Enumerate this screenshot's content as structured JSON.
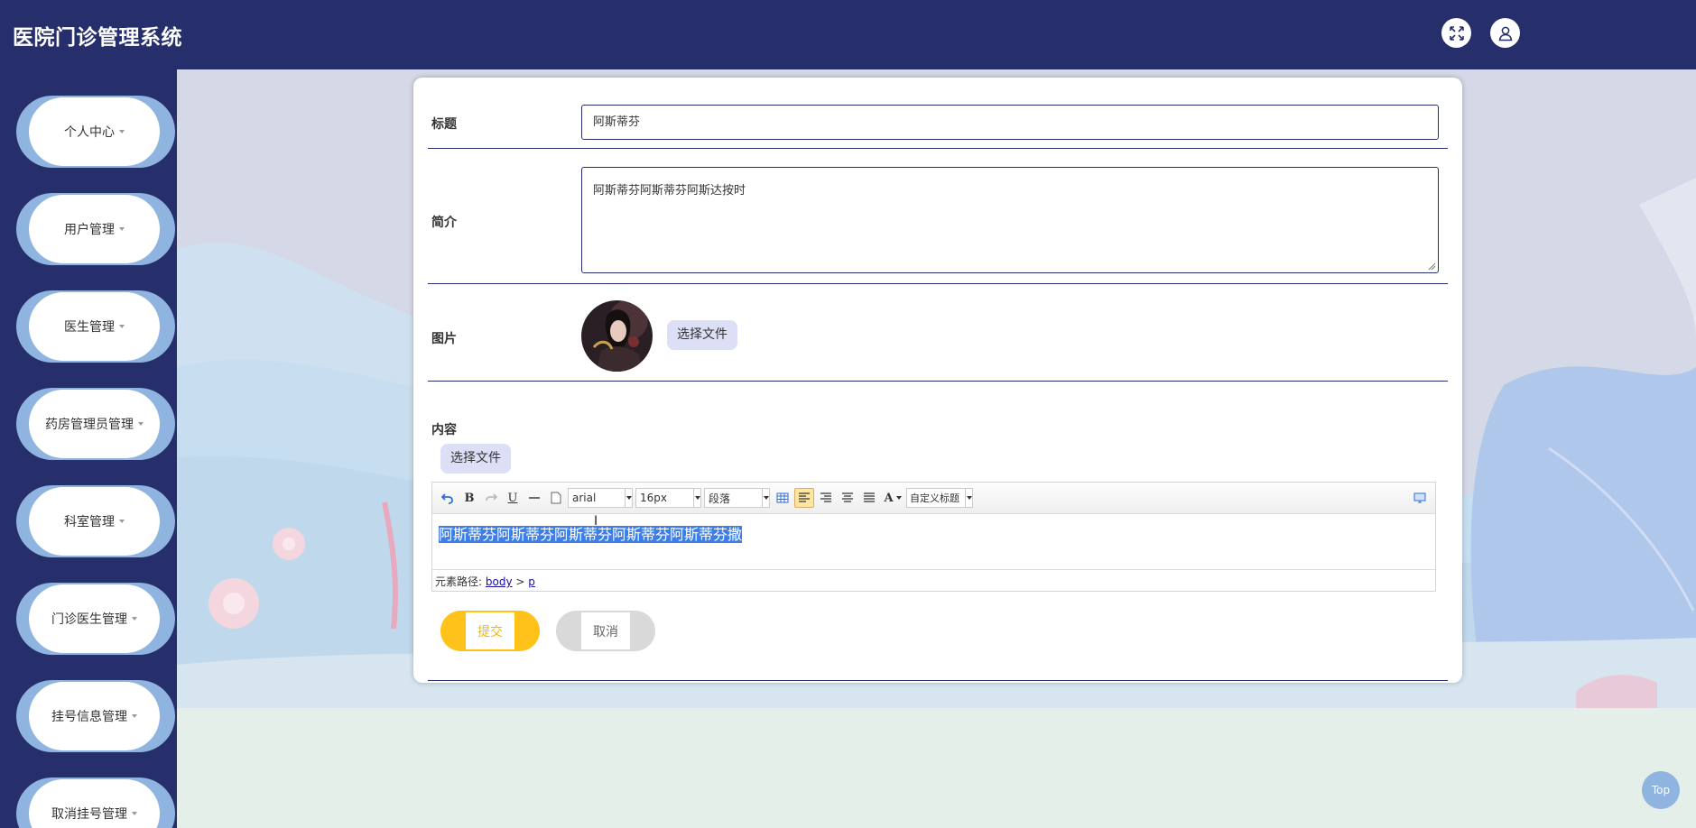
{
  "app": {
    "title": "医院门诊管理系统"
  },
  "header": {
    "fullscreen_icon": "expand-icon",
    "user_icon": "user-icon"
  },
  "sidebar": {
    "items": [
      {
        "label": "个人中心"
      },
      {
        "label": "用户管理"
      },
      {
        "label": "医生管理"
      },
      {
        "label": "药房管理员管理"
      },
      {
        "label": "科室管理"
      },
      {
        "label": "门诊医生管理"
      },
      {
        "label": "挂号信息管理"
      },
      {
        "label": "取消挂号管理"
      }
    ]
  },
  "form": {
    "title_label": "标题",
    "title_value": "阿斯蒂芬",
    "brief_label": "简介",
    "brief_value": "阿斯蒂芬阿斯蒂芬阿斯达按时",
    "image_label": "图片",
    "image_button": "选择文件",
    "content_label": "内容",
    "content_file_button": "选择文件",
    "editor": {
      "font_family": "arial",
      "font_size": "16px",
      "paragraph": "段落",
      "custom_heading": "自定义标题",
      "content": "阿斯蒂芬阿斯蒂芬阿斯蒂芬阿斯蒂芬阿斯蒂芬撒",
      "path_prefix": "元素路径:",
      "path_body": "body",
      "path_sep": ">",
      "path_p": "p"
    },
    "submit_label": "提交",
    "cancel_label": "取消"
  },
  "colors": {
    "navy": "#262f6b",
    "sidebar_accent": "#8fb4df",
    "submit": "#ffc21a",
    "cancel": "#d9d9d9",
    "file_button": "#dcdff6",
    "selection": "#3d7ee8"
  },
  "scroll_top": {
    "label": "Top"
  }
}
